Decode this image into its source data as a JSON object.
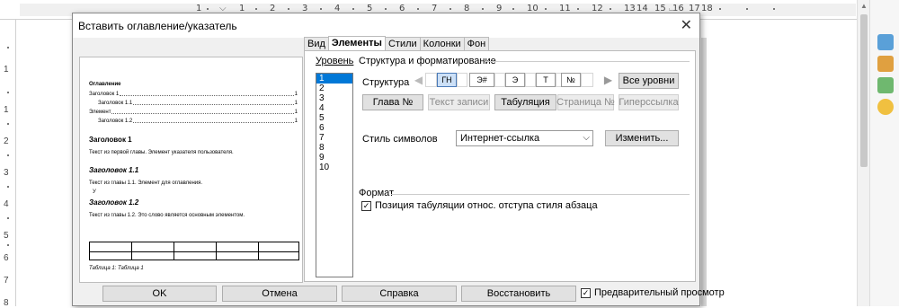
{
  "ruler": {
    "top_labels": [
      "1",
      "1",
      "2",
      "3",
      "4",
      "5",
      "6",
      "7",
      "8",
      "9",
      "10",
      "11",
      "12",
      "13",
      "14",
      "15",
      "16",
      "17",
      "18"
    ],
    "left_labels": [
      "1",
      "1",
      "2",
      "3",
      "4",
      "5",
      "6",
      "7",
      "8"
    ]
  },
  "dialog": {
    "title": "Вставить оглавление/указатель",
    "tabs": [
      "Вид",
      "Элементы",
      "Стили",
      "Колонки",
      "Фон"
    ],
    "active_tab": "Элементы",
    "preview": {
      "toc_title": "Оглавление",
      "toc_lines": [
        {
          "text": "Заголовок 1",
          "page": "1"
        },
        {
          "text": "Заголовок 1.1",
          "page": "1"
        },
        {
          "text": "Элемент",
          "page": "1"
        },
        {
          "text": "Заголовок 1.2",
          "page": "1"
        }
      ],
      "h1": "Заголовок 1",
      "p1": "Текст из первой главы. Элемент указателя пользователя.",
      "h11": "Заголовок 1.1",
      "p11": "Текст из главы 1.1. Элемент для оглавления.",
      "p11b": "У",
      "h12": "Заголовок 1.2",
      "p12": "Текст из главы 1.2. Это слово является основным элементом.",
      "caption": "Таблица 1: Таблица 1"
    },
    "level_label": "Уровень",
    "levels": [
      "1",
      "2",
      "3",
      "4",
      "5",
      "6",
      "7",
      "8",
      "9",
      "10"
    ],
    "selected_level": "1",
    "structure_heading": "Структура и форматирование",
    "structure_label": "Структура",
    "tokens": [
      "ГН",
      "Э#",
      "Э",
      "Т",
      "№"
    ],
    "all_levels_button": "Все уровни",
    "insert_buttons": {
      "chapter": "Глава №",
      "entry_text": "Текст записи",
      "tab": "Табуляция",
      "page": "Страница №",
      "hyperlink": "Гиперссылка"
    },
    "char_style_label": "Стиль символов",
    "char_style_value": "Интернет-ссылка",
    "edit_button": "Изменить...",
    "format_heading": "Формат",
    "tab_position_label": "Позиция табуляции относ. отступа стиля абзаца",
    "tab_position_checked": true,
    "footer": {
      "ok": "OK",
      "cancel": "Отмена",
      "help": "Справка",
      "reset": "Восстановить",
      "preview_label": "Предварительный просмотр",
      "preview_checked": true
    }
  }
}
